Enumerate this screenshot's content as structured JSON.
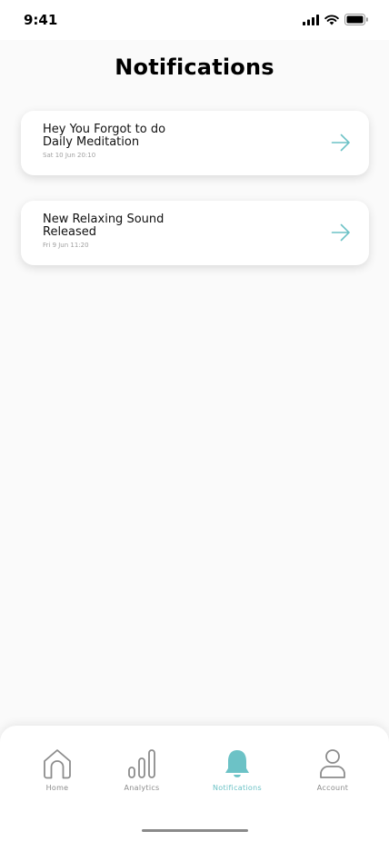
{
  "status": {
    "time": "9:41"
  },
  "page": {
    "title": "Notifications"
  },
  "notifications": [
    {
      "title": "Hey You Forgot to do\nDaily Meditation",
      "time": "Sat 10 Jun 20:10"
    },
    {
      "title": "New Relaxing Sound\nReleased",
      "time": "Fri 9 Jun 11:20"
    }
  ],
  "tabs": [
    {
      "label": "Home",
      "icon": "home-icon",
      "active": false
    },
    {
      "label": "Analytics",
      "icon": "analytics-icon",
      "active": false
    },
    {
      "label": "Notifications",
      "icon": "bell-icon",
      "active": true
    },
    {
      "label": "Account",
      "icon": "user-icon",
      "active": false
    }
  ],
  "colors": {
    "accent": "#6cc2c6",
    "inactive": "#8c8c8c",
    "background": "#fafafa"
  }
}
